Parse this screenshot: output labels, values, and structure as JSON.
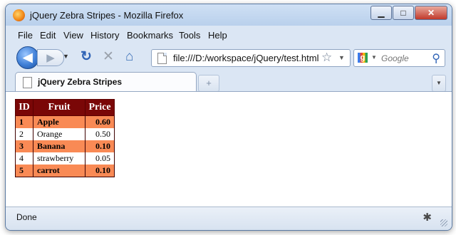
{
  "window": {
    "title": "jQuery Zebra Stripes - Mozilla Firefox"
  },
  "menu": [
    "File",
    "Edit",
    "View",
    "History",
    "Bookmarks",
    "Tools",
    "Help"
  ],
  "nav": {
    "url": "file:///D:/workspace/jQuery/test.html",
    "search_placeholder": "Google"
  },
  "tab": {
    "title": "jQuery Zebra Stripes",
    "new_tab_symbol": "+"
  },
  "table": {
    "headers": [
      "ID",
      "Fruit",
      "Price"
    ],
    "rows": [
      [
        "1",
        "Apple",
        "0.60"
      ],
      [
        "2",
        "Orange",
        "0.50"
      ],
      [
        "3",
        "Banana",
        "0.10"
      ],
      [
        "4",
        "strawberry",
        "0.05"
      ],
      [
        "5",
        "carrot",
        "0.10"
      ]
    ]
  },
  "status": {
    "text": "Done"
  },
  "colors": {
    "header_bg": "#7a0707",
    "stripe": "#f98a55",
    "plain": "#ffffff"
  }
}
